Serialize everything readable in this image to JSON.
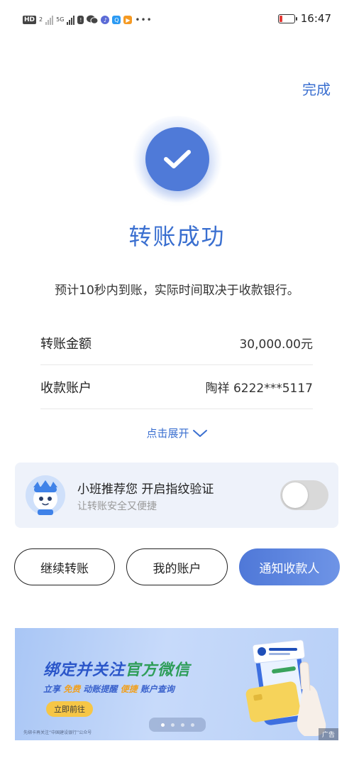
{
  "status_bar": {
    "hd_tag": "HD",
    "hd_sub": "2",
    "signal_5g": "5G",
    "time": "16:47",
    "icons": [
      "hd-icon",
      "signal-icon",
      "signal-5g-icon",
      "alert-icon",
      "wechat-icon",
      "music-icon",
      "browser-icon",
      "video-icon",
      "more-icon",
      "battery-icon"
    ]
  },
  "header": {
    "done_label": "完成"
  },
  "result": {
    "title": "转账成功",
    "subtitle": "预计10秒内到账，实际时间取决于收款银行。"
  },
  "details": [
    {
      "label": "转账金额",
      "value": "30,000.00元"
    },
    {
      "label": "收款账户",
      "value": "陶祥 6222***5117"
    }
  ],
  "expand_label": "点击展开",
  "fingerprint_card": {
    "title": "小班推荐您 开启指纹验证",
    "subtitle": "让转账安全又便捷",
    "toggle_on": false
  },
  "buttons": {
    "continue_transfer": "继续转账",
    "my_account": "我的账户",
    "notify_payee": "通知收款人"
  },
  "banner": {
    "title_part1": "绑定并关注",
    "title_part2": "官方微信",
    "line_part1": "立享",
    "line_free": "免费",
    "line_part2": "动账提醒",
    "line_convenient": "便捷",
    "line_part3": "账户查询",
    "cta": "立即前往",
    "footnote": "先绑卡再关注“中国建设银行”公众号",
    "ad_tag": "广告",
    "page_count": 4,
    "active_page": 1
  },
  "colors": {
    "accent": "#3a6fd0",
    "success_circle": "#4f7ad8",
    "card_bg": "#eef2fa",
    "toggle_off": "#d9d9d9"
  }
}
